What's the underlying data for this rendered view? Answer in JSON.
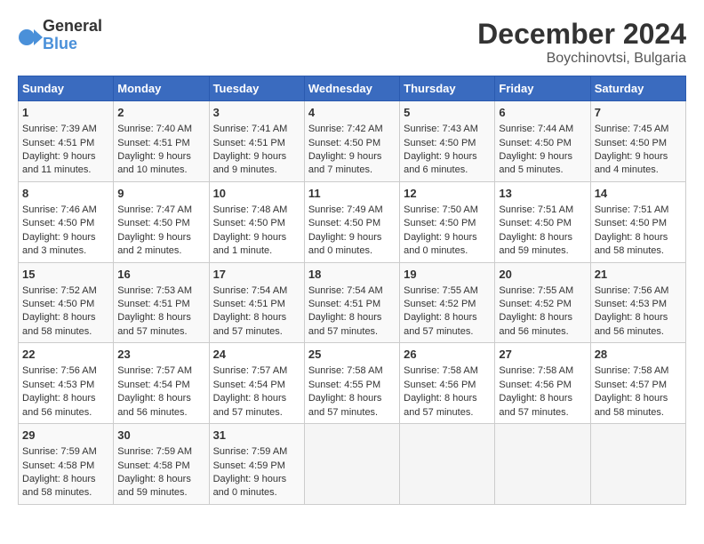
{
  "header": {
    "logo_line1": "General",
    "logo_line2": "Blue",
    "title": "December 2024",
    "subtitle": "Boychinovtsi, Bulgaria"
  },
  "days_of_week": [
    "Sunday",
    "Monday",
    "Tuesday",
    "Wednesday",
    "Thursday",
    "Friday",
    "Saturday"
  ],
  "weeks": [
    [
      {
        "day": "1",
        "info": "Sunrise: 7:39 AM\nSunset: 4:51 PM\nDaylight: 9 hours\nand 11 minutes."
      },
      {
        "day": "2",
        "info": "Sunrise: 7:40 AM\nSunset: 4:51 PM\nDaylight: 9 hours\nand 10 minutes."
      },
      {
        "day": "3",
        "info": "Sunrise: 7:41 AM\nSunset: 4:51 PM\nDaylight: 9 hours\nand 9 minutes."
      },
      {
        "day": "4",
        "info": "Sunrise: 7:42 AM\nSunset: 4:50 PM\nDaylight: 9 hours\nand 7 minutes."
      },
      {
        "day": "5",
        "info": "Sunrise: 7:43 AM\nSunset: 4:50 PM\nDaylight: 9 hours\nand 6 minutes."
      },
      {
        "day": "6",
        "info": "Sunrise: 7:44 AM\nSunset: 4:50 PM\nDaylight: 9 hours\nand 5 minutes."
      },
      {
        "day": "7",
        "info": "Sunrise: 7:45 AM\nSunset: 4:50 PM\nDaylight: 9 hours\nand 4 minutes."
      }
    ],
    [
      {
        "day": "8",
        "info": "Sunrise: 7:46 AM\nSunset: 4:50 PM\nDaylight: 9 hours\nand 3 minutes."
      },
      {
        "day": "9",
        "info": "Sunrise: 7:47 AM\nSunset: 4:50 PM\nDaylight: 9 hours\nand 2 minutes."
      },
      {
        "day": "10",
        "info": "Sunrise: 7:48 AM\nSunset: 4:50 PM\nDaylight: 9 hours\nand 1 minute."
      },
      {
        "day": "11",
        "info": "Sunrise: 7:49 AM\nSunset: 4:50 PM\nDaylight: 9 hours\nand 0 minutes."
      },
      {
        "day": "12",
        "info": "Sunrise: 7:50 AM\nSunset: 4:50 PM\nDaylight: 9 hours\nand 0 minutes."
      },
      {
        "day": "13",
        "info": "Sunrise: 7:51 AM\nSunset: 4:50 PM\nDaylight: 8 hours\nand 59 minutes."
      },
      {
        "day": "14",
        "info": "Sunrise: 7:51 AM\nSunset: 4:50 PM\nDaylight: 8 hours\nand 58 minutes."
      }
    ],
    [
      {
        "day": "15",
        "info": "Sunrise: 7:52 AM\nSunset: 4:50 PM\nDaylight: 8 hours\nand 58 minutes."
      },
      {
        "day": "16",
        "info": "Sunrise: 7:53 AM\nSunset: 4:51 PM\nDaylight: 8 hours\nand 57 minutes."
      },
      {
        "day": "17",
        "info": "Sunrise: 7:54 AM\nSunset: 4:51 PM\nDaylight: 8 hours\nand 57 minutes."
      },
      {
        "day": "18",
        "info": "Sunrise: 7:54 AM\nSunset: 4:51 PM\nDaylight: 8 hours\nand 57 minutes."
      },
      {
        "day": "19",
        "info": "Sunrise: 7:55 AM\nSunset: 4:52 PM\nDaylight: 8 hours\nand 57 minutes."
      },
      {
        "day": "20",
        "info": "Sunrise: 7:55 AM\nSunset: 4:52 PM\nDaylight: 8 hours\nand 56 minutes."
      },
      {
        "day": "21",
        "info": "Sunrise: 7:56 AM\nSunset: 4:53 PM\nDaylight: 8 hours\nand 56 minutes."
      }
    ],
    [
      {
        "day": "22",
        "info": "Sunrise: 7:56 AM\nSunset: 4:53 PM\nDaylight: 8 hours\nand 56 minutes."
      },
      {
        "day": "23",
        "info": "Sunrise: 7:57 AM\nSunset: 4:54 PM\nDaylight: 8 hours\nand 56 minutes."
      },
      {
        "day": "24",
        "info": "Sunrise: 7:57 AM\nSunset: 4:54 PM\nDaylight: 8 hours\nand 57 minutes."
      },
      {
        "day": "25",
        "info": "Sunrise: 7:58 AM\nSunset: 4:55 PM\nDaylight: 8 hours\nand 57 minutes."
      },
      {
        "day": "26",
        "info": "Sunrise: 7:58 AM\nSunset: 4:56 PM\nDaylight: 8 hours\nand 57 minutes."
      },
      {
        "day": "27",
        "info": "Sunrise: 7:58 AM\nSunset: 4:56 PM\nDaylight: 8 hours\nand 57 minutes."
      },
      {
        "day": "28",
        "info": "Sunrise: 7:58 AM\nSunset: 4:57 PM\nDaylight: 8 hours\nand 58 minutes."
      }
    ],
    [
      {
        "day": "29",
        "info": "Sunrise: 7:59 AM\nSunset: 4:58 PM\nDaylight: 8 hours\nand 58 minutes."
      },
      {
        "day": "30",
        "info": "Sunrise: 7:59 AM\nSunset: 4:58 PM\nDaylight: 8 hours\nand 59 minutes."
      },
      {
        "day": "31",
        "info": "Sunrise: 7:59 AM\nSunset: 4:59 PM\nDaylight: 9 hours\nand 0 minutes."
      },
      {
        "day": "",
        "info": ""
      },
      {
        "day": "",
        "info": ""
      },
      {
        "day": "",
        "info": ""
      },
      {
        "day": "",
        "info": ""
      }
    ]
  ]
}
